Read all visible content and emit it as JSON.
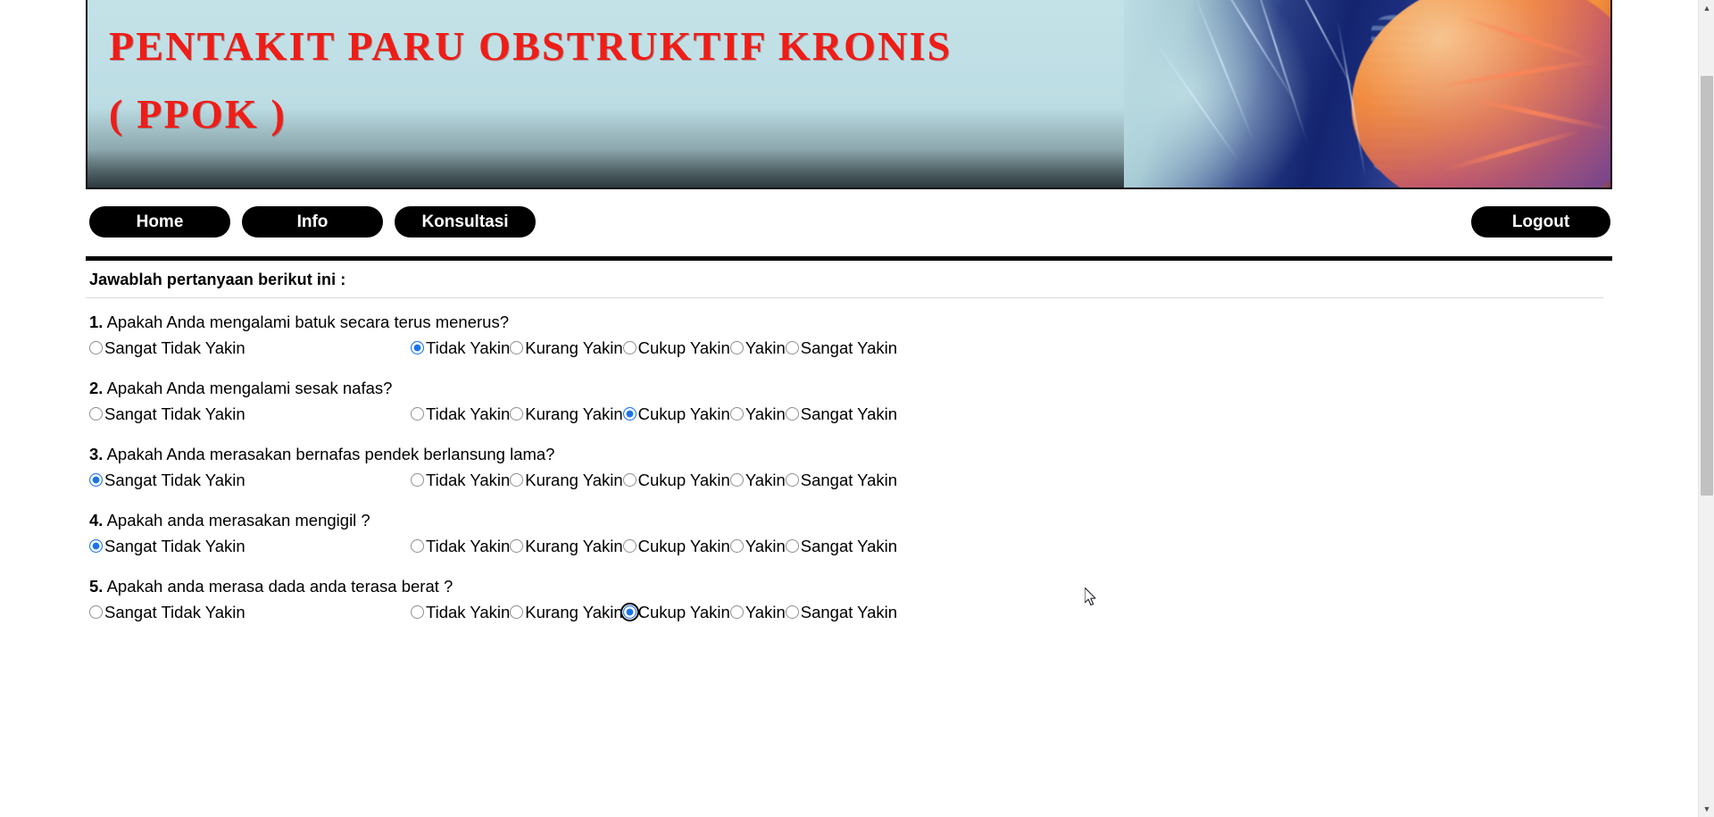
{
  "banner": {
    "title": "PENTAKIT PARU OBSTRUKTIF KRONIS\n( PPOK )",
    "title_color": "#ef1d17",
    "background_color": "#bddde4",
    "artwork": "lung-illustration"
  },
  "nav": {
    "items": [
      {
        "label": "Home",
        "name": "nav-home"
      },
      {
        "label": "Info",
        "name": "nav-info"
      },
      {
        "label": "Konsultasi",
        "name": "nav-konsultasi"
      }
    ],
    "logout_label": "Logout",
    "button_bg": "#000000",
    "button_text_color": "#ffffff"
  },
  "section": {
    "heading": "Jawablah pertanyaan berikut ini :"
  },
  "options": {
    "col1": [
      "Sangat Tidak Yakin",
      "Tidak Yakin",
      "Kurang Yakin"
    ],
    "col2": [
      "Cukup Yakin",
      "Yakin",
      "Sangat Yakin"
    ]
  },
  "questions": [
    {
      "number": "1.",
      "text": "Apakah Anda mengalami batuk secara terus menerus?",
      "selected": "Tidak Yakin",
      "focused": false,
      "o1": "Sangat Tidak Yakin",
      "o2": "Tidak Yakin",
      "o3": "Kurang Yakin",
      "o4": "Cukup Yakin",
      "o5": "Yakin",
      "o6": "Sangat Yakin"
    },
    {
      "number": "2.",
      "text": "Apakah Anda mengalami sesak nafas?",
      "selected": "Cukup Yakin",
      "focused": false,
      "o1": "Sangat Tidak Yakin",
      "o2": "Tidak Yakin",
      "o3": "Kurang Yakin",
      "o4": "Cukup Yakin",
      "o5": "Yakin",
      "o6": "Sangat Yakin"
    },
    {
      "number": "3.",
      "text": "Apakah Anda merasakan bernafas pendek berlansung lama?",
      "selected": "Sangat Tidak Yakin",
      "focused": false,
      "o1": "Sangat Tidak Yakin",
      "o2": "Tidak Yakin",
      "o3": "Kurang Yakin",
      "o4": "Cukup Yakin",
      "o5": "Yakin",
      "o6": "Sangat Yakin"
    },
    {
      "number": "4.",
      "text": "Apakah anda merasakan mengigil ?",
      "selected": "Sangat Tidak Yakin",
      "focused": false,
      "o1": "Sangat Tidak Yakin",
      "o2": "Tidak Yakin",
      "o3": "Kurang Yakin",
      "o4": "Cukup Yakin",
      "o5": "Yakin",
      "o6": "Sangat Yakin"
    },
    {
      "number": "5.",
      "text": "Apakah anda merasa dada anda terasa berat ?",
      "selected": "Cukup Yakin",
      "focused": true,
      "o1": "Sangat Tidak Yakin",
      "o2": "Tidak Yakin",
      "o3": "Kurang Yakin",
      "o4": "Cukup Yakin",
      "o5": "Yakin",
      "o6": "Sangat Yakin"
    }
  ],
  "scrollbar": {
    "up_arrow": "▲",
    "down_arrow": "▼"
  },
  "accent_color": "#1a73e8"
}
